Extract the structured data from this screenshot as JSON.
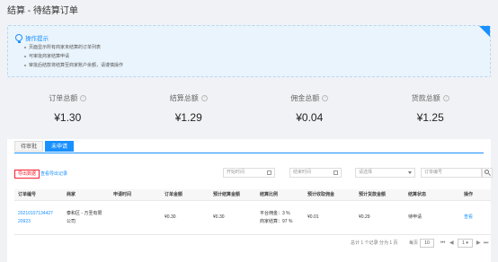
{
  "page": {
    "title": "结算 - 待结算订单"
  },
  "hint": {
    "title": "操作提示",
    "items": [
      "页面显示所有商家未结算的订单列表",
      "可审批商家结算申请",
      "审批后结款将结算至商家账户余额，请谨慎操作"
    ]
  },
  "stats": [
    {
      "label": "订单总额",
      "value": "¥1.30"
    },
    {
      "label": "结算总额",
      "value": "¥1.29"
    },
    {
      "label": "佣金总额",
      "value": "¥0.04"
    },
    {
      "label": "货款总额",
      "value": "¥1.25"
    }
  ],
  "tabs": [
    {
      "label": "待审批"
    },
    {
      "label": "未申请"
    }
  ],
  "toolbar": {
    "export_label": "导出数据",
    "export_records_label": "查看导出记录",
    "start_date_placeholder": "开始时间",
    "end_date_placeholder": "结束时间",
    "select_placeholder": "请选择",
    "order_no_placeholder": "订单编号"
  },
  "table": {
    "headers": [
      "订单编号",
      "商家",
      "申请时间",
      "订单金额",
      "预计结算金额",
      "结算比例",
      "预计收取佣金",
      "预计货款金额",
      "结算状态",
      "操作"
    ],
    "row": {
      "order_no_line1": "2021010713442​7",
      "order_no_line2": "20923",
      "merchant_line1": "泰和区 - 万圣有限",
      "merchant_line2": "公司",
      "apply_time": "",
      "order_amount": "¥0.30",
      "settle_amount": "¥0.30",
      "ratio_line1": "平台佣金：3 %",
      "ratio_line2": "商家结算：97 %",
      "commission": "¥0.01",
      "goods_amount": "¥0.29",
      "status": "待申请",
      "action": "查看"
    }
  },
  "pagination": {
    "summary": "总计 1 个记录 分为 1 页",
    "per_page_label": "每页",
    "per_page_value": "10",
    "current_page": "1",
    "first": "⏮",
    "prev": "◀",
    "next": "▶",
    "last": "⏭"
  },
  "colors": {
    "accent": "#1890ff",
    "danger": "#f5222d"
  }
}
